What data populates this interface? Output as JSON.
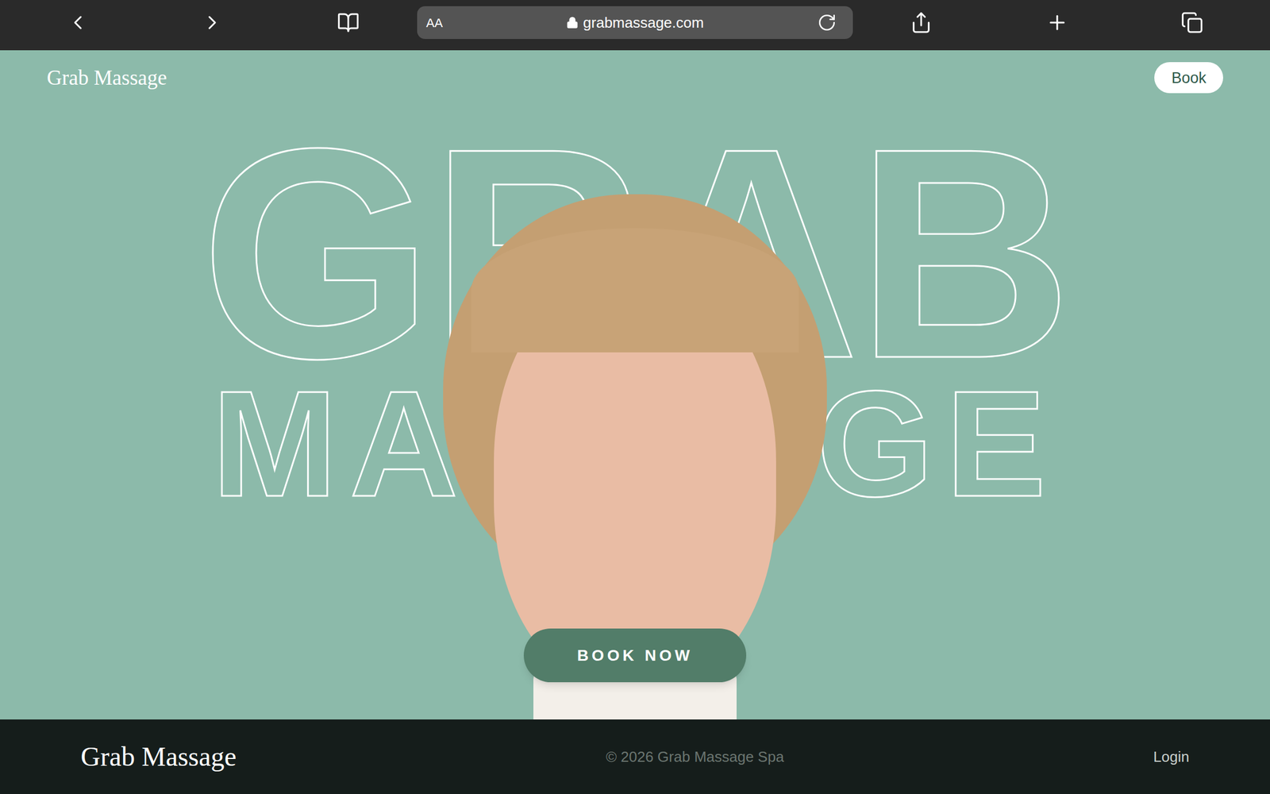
{
  "browser": {
    "address_bar_label": "AA",
    "url": "grabmassage.com"
  },
  "nav": {
    "logo": "Grab Massage",
    "book_button": "Book"
  },
  "hero": {
    "title_lines": [
      "GRAB",
      "MASSAGE"
    ],
    "cta": "BOOK NOW"
  },
  "footer": {
    "logo": "Grab Massage",
    "copyright": "© 2026 Grab Massage Spa",
    "login": "Login"
  }
}
